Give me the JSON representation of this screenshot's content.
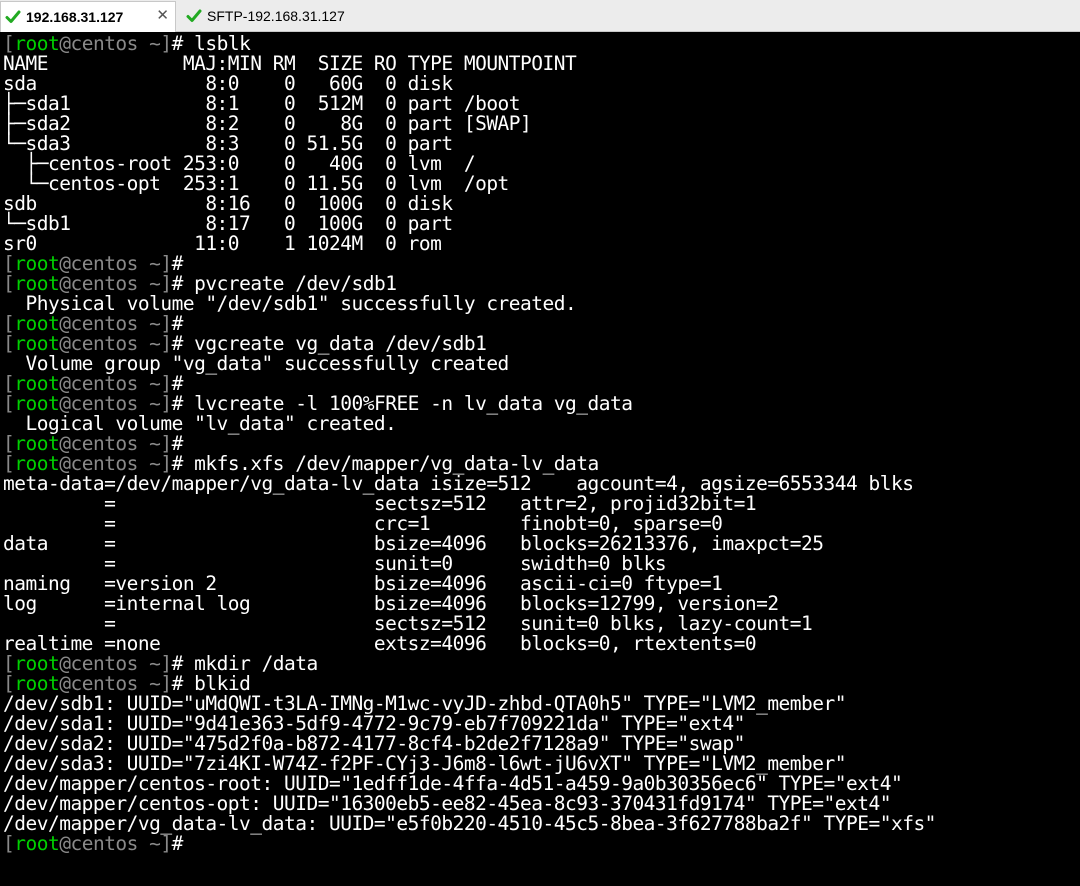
{
  "tabs": [
    {
      "label": "192.168.31.127",
      "active": true
    },
    {
      "label": "SFTP-192.168.31.127",
      "active": false
    }
  ],
  "prompt": {
    "open": "[",
    "user": "root",
    "at": "@",
    "host": "centos ~]",
    "symbol": "# "
  },
  "lines": [
    {
      "type": "cmd",
      "text": "lsblk"
    },
    {
      "type": "out",
      "text": "NAME            MAJ:MIN RM  SIZE RO TYPE MOUNTPOINT"
    },
    {
      "type": "out",
      "text": "sda               8:0    0   60G  0 disk"
    },
    {
      "type": "out",
      "text": "├─sda1            8:1    0  512M  0 part /boot"
    },
    {
      "type": "out",
      "text": "├─sda2            8:2    0    8G  0 part [SWAP]"
    },
    {
      "type": "out",
      "text": "└─sda3            8:3    0 51.5G  0 part"
    },
    {
      "type": "out",
      "text": "  ├─centos-root 253:0    0   40G  0 lvm  /"
    },
    {
      "type": "out",
      "text": "  └─centos-opt  253:1    0 11.5G  0 lvm  /opt"
    },
    {
      "type": "out",
      "text": "sdb               8:16   0  100G  0 disk"
    },
    {
      "type": "out",
      "text": "└─sdb1            8:17   0  100G  0 part"
    },
    {
      "type": "out",
      "text": "sr0              11:0    1 1024M  0 rom"
    },
    {
      "type": "cmd",
      "text": ""
    },
    {
      "type": "cmd",
      "text": "pvcreate /dev/sdb1"
    },
    {
      "type": "out",
      "text": "  Physical volume \"/dev/sdb1\" successfully created."
    },
    {
      "type": "cmd",
      "text": ""
    },
    {
      "type": "cmd",
      "text": "vgcreate vg_data /dev/sdb1"
    },
    {
      "type": "out",
      "text": "  Volume group \"vg_data\" successfully created"
    },
    {
      "type": "cmd",
      "text": ""
    },
    {
      "type": "cmd",
      "text": "lvcreate -l 100%FREE -n lv_data vg_data"
    },
    {
      "type": "out",
      "text": "  Logical volume \"lv_data\" created."
    },
    {
      "type": "cmd",
      "text": ""
    },
    {
      "type": "cmd",
      "text": "mkfs.xfs /dev/mapper/vg_data-lv_data"
    },
    {
      "type": "out",
      "text": "meta-data=/dev/mapper/vg_data-lv_data isize=512    agcount=4, agsize=6553344 blks"
    },
    {
      "type": "out",
      "text": "         =                       sectsz=512   attr=2, projid32bit=1"
    },
    {
      "type": "out",
      "text": "         =                       crc=1        finobt=0, sparse=0"
    },
    {
      "type": "out",
      "text": "data     =                       bsize=4096   blocks=26213376, imaxpct=25"
    },
    {
      "type": "out",
      "text": "         =                       sunit=0      swidth=0 blks"
    },
    {
      "type": "out",
      "text": "naming   =version 2              bsize=4096   ascii-ci=0 ftype=1"
    },
    {
      "type": "out",
      "text": "log      =internal log           bsize=4096   blocks=12799, version=2"
    },
    {
      "type": "out",
      "text": "         =                       sectsz=512   sunit=0 blks, lazy-count=1"
    },
    {
      "type": "out",
      "text": "realtime =none                   extsz=4096   blocks=0, rtextents=0"
    },
    {
      "type": "cmd",
      "text": "mkdir /data"
    },
    {
      "type": "cmd",
      "text": "blkid"
    },
    {
      "type": "out",
      "text": "/dev/sdb1: UUID=\"uMdQWI-t3LA-IMNg-M1wc-vyJD-zhbd-QTA0h5\" TYPE=\"LVM2_member\""
    },
    {
      "type": "out",
      "text": "/dev/sda1: UUID=\"9d41e363-5df9-4772-9c79-eb7f709221da\" TYPE=\"ext4\""
    },
    {
      "type": "out",
      "text": "/dev/sda2: UUID=\"475d2f0a-b872-4177-8cf4-b2de2f7128a9\" TYPE=\"swap\""
    },
    {
      "type": "out",
      "text": "/dev/sda3: UUID=\"7zi4KI-W74Z-f2PF-CYj3-J6m8-l6wt-jU6vXT\" TYPE=\"LVM2_member\""
    },
    {
      "type": "out",
      "text": "/dev/mapper/centos-root: UUID=\"1edff1de-4ffa-4d51-a459-9a0b30356ec6\" TYPE=\"ext4\""
    },
    {
      "type": "out",
      "text": "/dev/mapper/centos-opt: UUID=\"16300eb5-ee82-45ea-8c93-370431fd9174\" TYPE=\"ext4\""
    },
    {
      "type": "out",
      "text": "/dev/mapper/vg_data-lv_data: UUID=\"e5f0b220-4510-45c5-8bea-3f627788ba2f\" TYPE=\"xfs\""
    },
    {
      "type": "cmd",
      "text": ""
    }
  ],
  "colors": {
    "background": "#000000",
    "text": "#ffffff",
    "prompt_user": "#00d000",
    "prompt_bracket": "#8a8a8a",
    "tab_check": "#22aa22"
  },
  "icons": {
    "tab_status": "check-icon",
    "tab_close": "close-icon"
  }
}
